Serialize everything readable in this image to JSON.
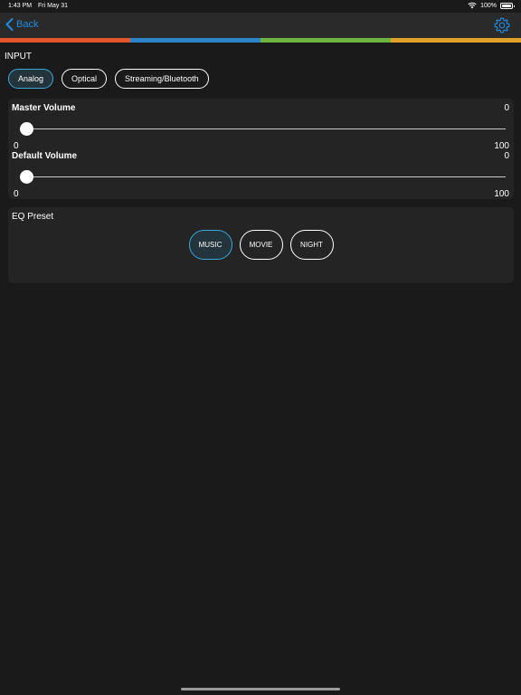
{
  "status_bar": {
    "time": "1:43 PM",
    "date": "Fri May 31",
    "battery": "100%"
  },
  "nav": {
    "back_label": "Back",
    "accent_color": "#1d8ce3"
  },
  "stripe_colors": [
    "#e0552b",
    "#2a84c6",
    "#6db33f",
    "#e0a22a"
  ],
  "input": {
    "label": "INPUT",
    "options": [
      {
        "label": "Analog",
        "selected": true
      },
      {
        "label": "Optical",
        "selected": false
      },
      {
        "label": "Streaming/Bluetooth",
        "selected": false
      }
    ]
  },
  "master_volume": {
    "title": "Master Volume",
    "value": "0",
    "min": "0",
    "max": "100",
    "level": 0
  },
  "default_volume": {
    "title": "Default Volume",
    "value": "0",
    "min": "0",
    "max": "100",
    "level": 0
  },
  "eq": {
    "title": "EQ Preset",
    "options": [
      {
        "label": "MUSIC",
        "selected": true
      },
      {
        "label": "MOVIE",
        "selected": false
      },
      {
        "label": "NIGHT",
        "selected": false
      }
    ]
  }
}
